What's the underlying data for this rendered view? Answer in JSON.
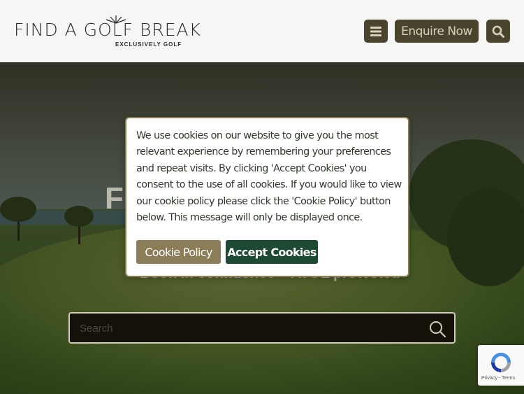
{
  "header": {
    "logo_main": "FIND A GOLF BREAK",
    "logo_sub": "EXCLUSIVELY GOLF",
    "menu_icon": "hamburger-menu-icon",
    "enquire_label": "Enquire Now",
    "search_icon": "search-icon"
  },
  "hero": {
    "title": "F                                    F",
    "subtitle": "Book in confidence – ATOL protected",
    "search": {
      "placeholder": "Search",
      "icon": "search-icon"
    }
  },
  "cookie_dialog": {
    "message": "We use cookies on our website to give you the most relevant experience by remembering your preferences and repeat visits. By clicking 'Accept Cookies' you consent to the use of all cookies. If you would like to view our cookie policy please click the 'Cookie Policy' button below. This message will only be displayed once.",
    "policy_label": "Cookie Policy",
    "accept_label": "Accept Cookies"
  },
  "recaptcha": {
    "text": "Privacy - Terms"
  },
  "colors": {
    "header_bg": "#f6f6f4",
    "header_button": "#4a442f",
    "policy_button": "#8b7d57",
    "accept_button": "#1d4a32"
  }
}
